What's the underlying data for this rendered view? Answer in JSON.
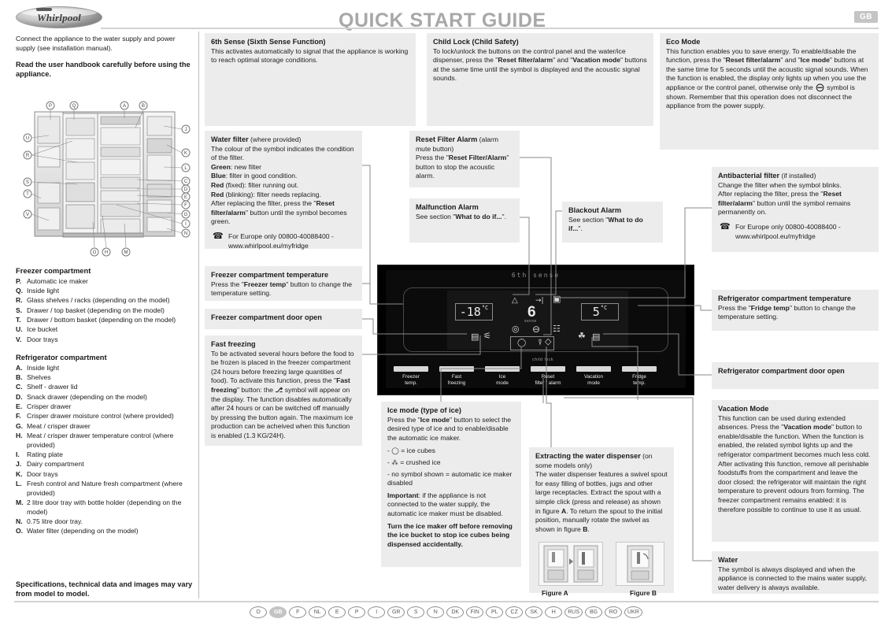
{
  "header": {
    "title": "QUICK START GUIDE",
    "brand": "Whirlpool",
    "locale_badge": "GB"
  },
  "intro": {
    "line1": "Connect the appliance to the water supply and power supply (see installation manual).",
    "line2": "Read the user handbook carefully before using the appliance."
  },
  "legend": {
    "freezer_title": "Freezer compartment",
    "freezer_items": [
      {
        "key": "P.",
        "text": "Automatic ice maker"
      },
      {
        "key": "Q.",
        "text": "Inside light"
      },
      {
        "key": "R.",
        "text": "Glass shelves / racks (depending on the model)"
      },
      {
        "key": "S.",
        "text": "Drawer / top basket (depending on the model)"
      },
      {
        "key": "T.",
        "text": "Drawer / bottom basket (depending on the model)"
      },
      {
        "key": "U.",
        "text": "Ice bucket"
      },
      {
        "key": "V.",
        "text": "Door trays"
      }
    ],
    "fridge_title": "Refrigerator compartment",
    "fridge_items": [
      {
        "key": "A.",
        "text": "Inside light"
      },
      {
        "key": "B.",
        "text": "Shelves"
      },
      {
        "key": "C.",
        "text": "Shelf - drawer lid"
      },
      {
        "key": "D.",
        "text": "Snack drawer (depending on the model)"
      },
      {
        "key": "E.",
        "text": "Crisper drawer"
      },
      {
        "key": "F.",
        "text": "Crisper drawer moisture control (where provided)"
      },
      {
        "key": "G.",
        "text": "Meat / crisper drawer"
      },
      {
        "key": "H.",
        "text": "Meat / crisper drawer temperature control (where provided)"
      },
      {
        "key": "I.",
        "text": "Rating plate"
      },
      {
        "key": "J.",
        "text": "Dairy compartment"
      },
      {
        "key": "K.",
        "text": "Door trays"
      },
      {
        "key": "L.",
        "text": "Fresh control and Nature fresh compartment (where provided)"
      },
      {
        "key": "M.",
        "text": "2 litre door tray with bottle holder (depending on the model)"
      },
      {
        "key": "N.",
        "text": "0.75 litre door tray."
      },
      {
        "key": "O.",
        "text": "Water filter (depending on the model)"
      }
    ],
    "footer_note": "Specifications, technical data and images may vary from model to model."
  },
  "boxes": {
    "sixth_sense": {
      "title": "6th Sense (Sixth Sense Function)",
      "body": "This activates automatically to signal that the appliance is working to reach optimal storage conditions."
    },
    "child_lock": {
      "title": "Child Lock (Child Safety)",
      "body_1": "To lock/unlock the buttons on the control panel and the water/ice dispenser, press the \"",
      "b1": "Reset filter/alarm",
      "body_2": "\" and \"",
      "b2": "Vacation mode",
      "body_3": "\" buttons at the same time until the symbol is displayed and the acoustic signal sounds."
    },
    "eco_mode": {
      "title": "Eco Mode",
      "body_1": "This function enables you to save energy. To enable/disable the function, press the \"",
      "b1": "Reset filter/alarm",
      "body_2": "\" and \"",
      "b2": "Ice mode",
      "body_3": "\" buttons at the same time for 5 seconds until the acoustic signal sounds. When the function is enabled, the display only lights up when you use the appliance or the control panel, otherwise only the",
      "symbol": "⊖",
      "body_4": "symbol is shown.",
      "body_5": "Remember that this operation does not disconnect the appliance from the power supply."
    },
    "water_filter": {
      "title": "Water filter",
      "title_sub": " (where provided)",
      "l1": "The colour of the symbol indicates the condition of the filter.",
      "g_key": "Green",
      "g_val": ": new filter",
      "bl_key": "Blue",
      "bl_val": ": filter in good condition.",
      "r1_key": "Red",
      "r1_val": " (fixed): filter running out.",
      "r2_key": "Red",
      "r2_val": " (blinking): filter needs replacing.",
      "l2a": "After replacing the filter, press the \"",
      "l2b": "Reset filter/alarm",
      "l2c": "\" button until the symbol becomes green.",
      "phone_icon": "☎",
      "phone": "For Europe only 00800-40088400 - www.whirlpool.eu/myfridge"
    },
    "reset_filter_alarm": {
      "title": "Reset Filter Alarm",
      "title_sub": " (alarm mute button)",
      "b1": "Press the \"",
      "b2": "Reset Filter/Alarm",
      "b3": "\" button to stop the acoustic alarm."
    },
    "malfunction_alarm": {
      "title": "Malfunction Alarm",
      "b1": "See section \"",
      "b2": "What to do if...",
      "b3": "\"."
    },
    "blackout_alarm": {
      "title": "Blackout Alarm",
      "b1": "See section \"",
      "b2": "What to do if...",
      "b3": "\"."
    },
    "antibacterial_filter": {
      "title": "Antibacterial filter",
      "title_sub": " (if installed)",
      "l1": "Change the filter when the symbol blinks.",
      "l2a": "After replacing the filter, press the \"",
      "l2b": "Reset filter/alarm",
      "l2c": "\" button until the symbol remains permanently on.",
      "phone_icon": "☎",
      "phone_l1": "For Europe only 00800-40088400 -",
      "phone_l2": "www.whirlpool.eu/myfridge"
    },
    "freezer_temp": {
      "title": "Freezer compartment temperature",
      "b1": "Press the \"",
      "b2": "Freezer temp",
      "b3": "\" button to change the temperature setting."
    },
    "freezer_door_open": {
      "title": "Freezer compartment door open"
    },
    "fast_freezing": {
      "title": "Fast freezing",
      "p1": "To be activated several hours before the food to be frozen is placed in the freezer compartment (24 hours before freezing large quantities of food).",
      "p2a": "To activate this function, press the \"",
      "p2b": "Fast freezing",
      "p2c": "\" button: the",
      "p2sym": "⎇",
      "p2d": "symbol will appear on the display.",
      "p3": "The function disables automatically after 24 hours or can be switched off manually by pressing the button again.",
      "p4": "The maximum ice production can be acheived when this function is enabled (1.3 KG/24H)."
    },
    "ice_mode": {
      "title": "Ice mode (type of ice)",
      "p1a": "Press the \"",
      "p1b": "Ice mode",
      "p1c": "\" button to select the desired type of ice and to enable/disable the automatic ice maker.",
      "bullet1": "- ◯ = ice cubes",
      "bullet2": "- ⁂ = crushed ice",
      "bullet3": "- no symbol shown = automatic ice maker disabled",
      "impa": "Important",
      "impb": ": if the appliance is not connected to the water supply, the automatic ice maker must be disabled.",
      "warn": "Turn the ice maker off before removing the ice bucket to stop ice cubes being dispensed accidentally."
    },
    "extract_dispenser": {
      "title": "Extracting the water dispenser",
      "title_sub": " (on some models only)",
      "p1": "The water dispenser features a swivel spout for easy filling of bottles, jugs and other large receptacles. Extract the spout with a simple click (press and release) as shown in figure ",
      "a": "A",
      "p2": ". To return the spout to the initial position, manually rotate the swivel as shown in figure ",
      "b": "B",
      "p3": ".",
      "cap_a": "Figure A",
      "cap_b": "Figure B"
    },
    "fridge_temp": {
      "title": "Refrigerator compartment temperature",
      "b1": "Press the \"",
      "b2": "Fridge temp",
      "b3": "\" button to change the temperature setting."
    },
    "fridge_door_open": {
      "title": "Refrigerator compartment door open"
    },
    "vacation_mode": {
      "title": "Vacation Mode",
      "p1": "This function can be used during extended absences.",
      "p2a": "Press the \"",
      "p2b": "Vacation mode",
      "p2c": "\" button to enable/disable the function. When the function is enabled, the related symbol lights up and the refrigerator compartment becomes much less cold. After activating this function, remove all perishable foodstuffs from the compartment and leave the door closed: the refrigerator will maintain the right temperature to prevent odours from forming.",
      "p3": "The freezer compartment remains enabled: it is therefore possible to continue to use it as usual."
    },
    "water": {
      "title": "Water",
      "body": "The symbol is always displayed and when the appliance is connected to the mains water supply, water delivery is always available."
    }
  },
  "control_panel": {
    "sixth_sense_label": "6th sense",
    "freezer_display": "-18",
    "freezer_unit": "°C",
    "fridge_display": "5",
    "fridge_unit": "°C",
    "six_digit": "6",
    "six_caption": "sense",
    "child_lock_label": "child lock",
    "buttons": [
      {
        "l1": "Freezer",
        "l2": "temp."
      },
      {
        "l1": "Fast",
        "l2": "freezing"
      },
      {
        "l1": "Ice",
        "l2": "mode"
      },
      {
        "l1": "Reset",
        "l2": "filter / alarm"
      },
      {
        "l1": "Vacation",
        "l2": "mode"
      },
      {
        "l1": "Fridge",
        "l2": "temp."
      }
    ]
  },
  "languages": [
    {
      "code": "D",
      "active": false
    },
    {
      "code": "GB",
      "active": true
    },
    {
      "code": "F",
      "active": false
    },
    {
      "code": "NL",
      "active": false
    },
    {
      "code": "E",
      "active": false
    },
    {
      "code": "P",
      "active": false
    },
    {
      "code": "I",
      "active": false
    },
    {
      "code": "GR",
      "active": false
    },
    {
      "code": "S",
      "active": false
    },
    {
      "code": "N",
      "active": false
    },
    {
      "code": "DK",
      "active": false
    },
    {
      "code": "FIN",
      "active": false
    },
    {
      "code": "PL",
      "active": false
    },
    {
      "code": "CZ",
      "active": false
    },
    {
      "code": "SK",
      "active": false
    },
    {
      "code": "H",
      "active": false
    },
    {
      "code": "RUS",
      "active": false
    },
    {
      "code": "BG",
      "active": false
    },
    {
      "code": "RO",
      "active": false
    },
    {
      "code": "UKR",
      "active": false
    }
  ]
}
